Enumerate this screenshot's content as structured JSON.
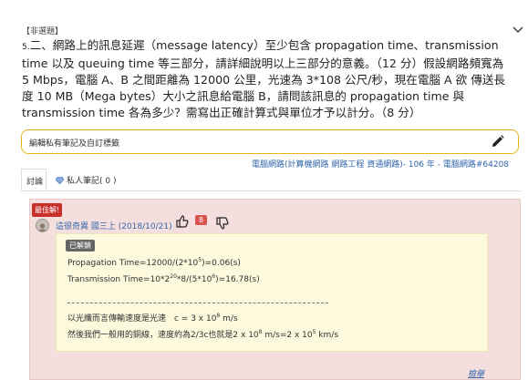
{
  "question": {
    "tag": "【非選題】",
    "number": "5.",
    "text": "二、網路上的訊息延遲（message latency）至少包含 propagation time、transmission time 以及 queuing time 等三部分，請詳細說明以上三部分的意義。（12 分）假設網路頻寬為 5 Mbps，電腦 A、B 之間距離為 12000 公里，光速為 3*108 公尺/秒，現在電腦 A 欲 傳送長度 10 MB（Mega bytes）大小之訊息給電腦 B，請問該訊息的 propagation time 與 transmission time 各為多少？需寫出正確計算式與單位才予以計分。（8 分）"
  },
  "note_bar": {
    "placeholder": "編輯私有筆記及自訂標籤"
  },
  "source": "電腦網路(計算機網路 網路工程 資通網路)- 106 年 - 電腦網路#64208",
  "tabs": [
    {
      "label": "討論"
    },
    {
      "label": "私人筆記( 0 )"
    }
  ],
  "answer": {
    "best_badge": "最佳解!",
    "author": "這很奇異 國三上 (2018/10/21)",
    "likes": "8",
    "solved_badge": "已解鎖",
    "lines": {
      "l1a": "Propagation Time=12000/(2*10",
      "l1sup": "5",
      "l1b": ")=0.06(s)",
      "l2a": "Transmission Time=10*2",
      "l2sup1": "20",
      "l2b": "*8/(5*10",
      "l2sup2": "6",
      "l2c": ")=16.78(s)",
      "l3a": "以光纖而言傳輸速度是光速　c = 3 x 10",
      "l3sup": "8",
      "l3b": "  m/s",
      "l4a": "然後我們一般用的銅線，速度約為2/3c也就是2 x 10",
      "l4sup1": "8",
      "l4b": " m/s=2 x 10",
      "l4sup2": "5",
      "l4c": " km/s"
    },
    "like_link": "檢舉"
  },
  "colors": {
    "accent": "#e8b31c",
    "best": "#c9302c",
    "link": "#3366aa",
    "card_bg": "#f4dede",
    "answer_bg": "#fcf9dc"
  }
}
